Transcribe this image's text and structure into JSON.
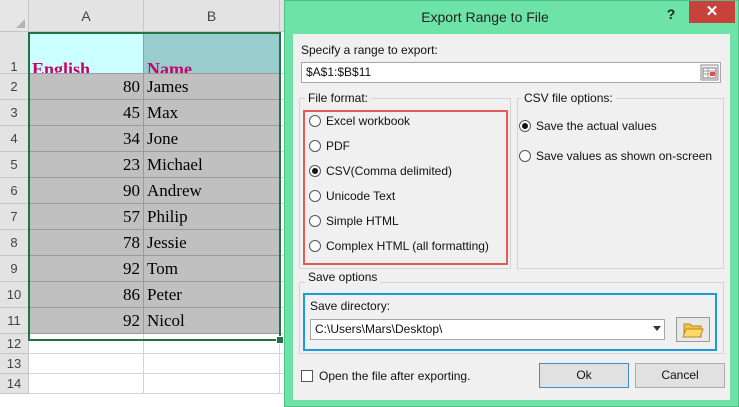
{
  "sheet": {
    "columns": [
      "A",
      "B"
    ],
    "rows": [
      {
        "num": "1",
        "a": "English",
        "b": "Name"
      },
      {
        "num": "2",
        "a": "80",
        "b": "James"
      },
      {
        "num": "3",
        "a": "45",
        "b": "Max"
      },
      {
        "num": "4",
        "a": "34",
        "b": "Jone"
      },
      {
        "num": "5",
        "a": "23",
        "b": "Michael"
      },
      {
        "num": "6",
        "a": "90",
        "b": "Andrew"
      },
      {
        "num": "7",
        "a": "57",
        "b": "Philip"
      },
      {
        "num": "8",
        "a": "78",
        "b": "Jessie"
      },
      {
        "num": "9",
        "a": "92",
        "b": "Tom"
      },
      {
        "num": "10",
        "a": "86",
        "b": "Peter"
      },
      {
        "num": "11",
        "a": "92",
        "b": "Nicol"
      },
      {
        "num": "12",
        "a": "",
        "b": ""
      },
      {
        "num": "13",
        "a": "",
        "b": ""
      },
      {
        "num": "14",
        "a": "",
        "b": ""
      }
    ],
    "colors": {
      "header_fill_a": "#ccffff",
      "header_fill_b": "#99cccc",
      "header_text": "#cc0066",
      "data_fill": "#c0c0c0",
      "selection_border": "#217346"
    }
  },
  "dialog": {
    "title": "Export Range to File",
    "help_label": "?",
    "close_label": "✕",
    "range_label": "Specify a range to export:",
    "range_value": "$A$1:$B$11",
    "file_format": {
      "legend": "File format:",
      "options": [
        {
          "label": "Excel workbook",
          "selected": false
        },
        {
          "label": "PDF",
          "selected": false
        },
        {
          "label": "CSV(Comma delimited)",
          "selected": true
        },
        {
          "label": "Unicode Text",
          "selected": false
        },
        {
          "label": "Simple HTML",
          "selected": false
        },
        {
          "label": "Complex HTML (all formatting)",
          "selected": false
        }
      ]
    },
    "csv_options": {
      "legend": "CSV file options:",
      "options": [
        {
          "label": "Save the actual values",
          "selected": true
        },
        {
          "label": "Save values as shown on-screen",
          "selected": false
        }
      ]
    },
    "save_options": {
      "legend": "Save options",
      "directory_label": "Save directory:",
      "directory_value": "C:\\Users\\Mars\\Desktop\\"
    },
    "open_after_label": "Open the file after exporting.",
    "open_after_checked": false,
    "ok_label": "Ok",
    "cancel_label": "Cancel",
    "colors": {
      "frame": "#6ee3a7",
      "close": "#c9413b",
      "format_highlight": "#e25b5b",
      "directory_highlight": "#1a9ad6"
    },
    "icons": {
      "range_picker": "range-select-icon",
      "folder": "folder-open-icon",
      "dropdown": "chevron-down-icon"
    }
  }
}
